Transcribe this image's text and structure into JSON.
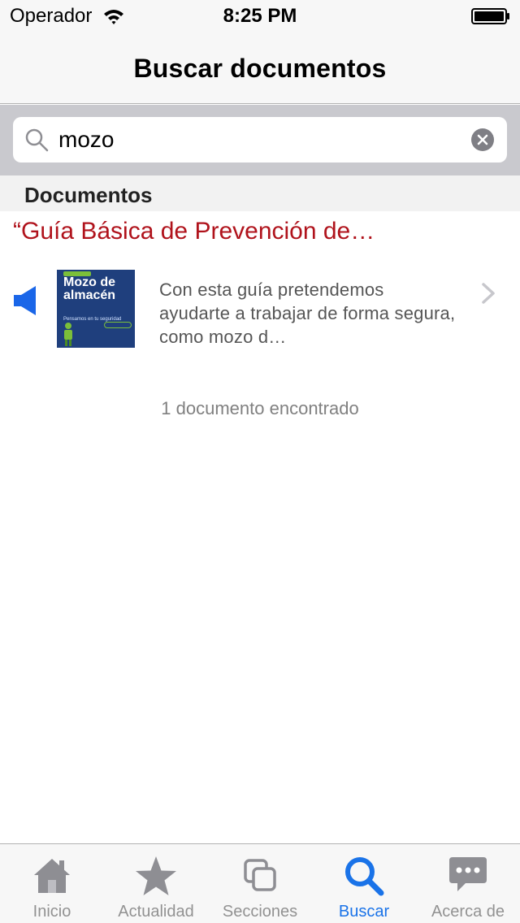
{
  "status_bar": {
    "carrier": "Operador",
    "time": "8:25 PM"
  },
  "nav": {
    "title": "Buscar documentos"
  },
  "search": {
    "value": "mozo"
  },
  "section": {
    "header": "Documentos"
  },
  "results": [
    {
      "title": "“Guía Básica de Prevención de…",
      "description": "Con esta guía pretendemos ayudarte a trabajar de forma segura, como mozo d…",
      "cover": {
        "title": "Mozo de almacén",
        "subtitle": "Pensamos en tu seguridad"
      }
    }
  ],
  "result_count": "1 documento encontrado",
  "tabs": [
    {
      "label": "Inicio",
      "icon": "home-icon",
      "active": false
    },
    {
      "label": "Actualidad",
      "icon": "star-icon",
      "active": false
    },
    {
      "label": "Secciones",
      "icon": "sections-icon",
      "active": false
    },
    {
      "label": "Buscar",
      "icon": "search-icon",
      "active": true
    },
    {
      "label": "Acerca de",
      "icon": "chat-bubble-icon",
      "active": false
    }
  ],
  "colors": {
    "accent": "#1a73e8",
    "result_title": "#b0131c",
    "speaker": "#1a66e8"
  }
}
